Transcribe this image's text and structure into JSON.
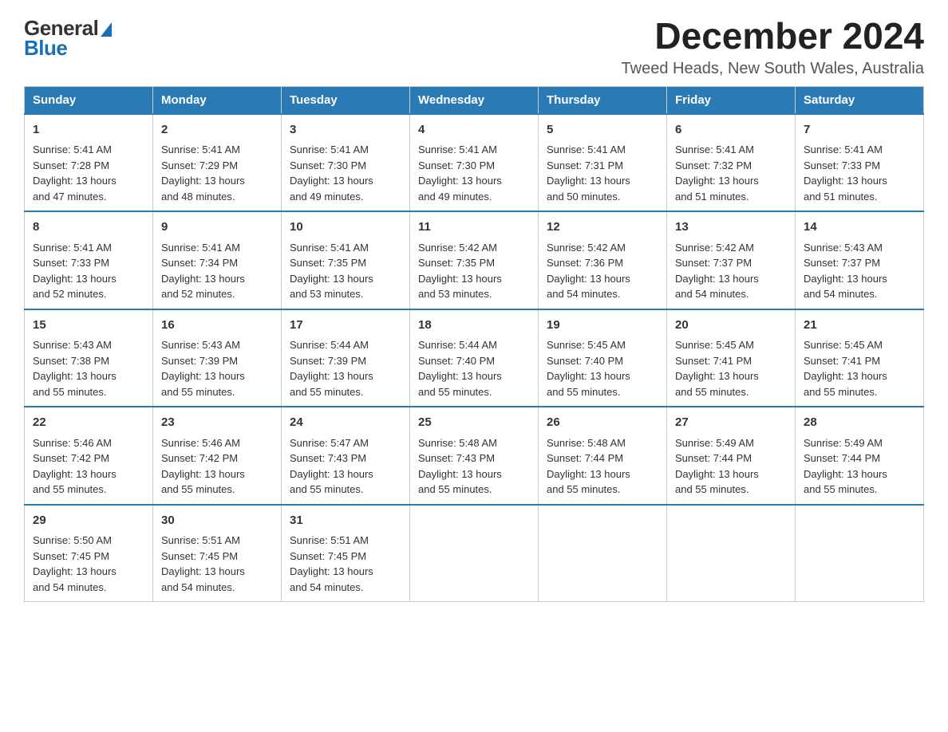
{
  "header": {
    "month_year": "December 2024",
    "location": "Tweed Heads, New South Wales, Australia",
    "logo_general": "General",
    "logo_blue": "Blue"
  },
  "weekdays": [
    "Sunday",
    "Monday",
    "Tuesday",
    "Wednesday",
    "Thursday",
    "Friday",
    "Saturday"
  ],
  "weeks": [
    [
      {
        "day": "1",
        "sunrise": "5:41 AM",
        "sunset": "7:28 PM",
        "daylight": "13 hours and 47 minutes."
      },
      {
        "day": "2",
        "sunrise": "5:41 AM",
        "sunset": "7:29 PM",
        "daylight": "13 hours and 48 minutes."
      },
      {
        "day": "3",
        "sunrise": "5:41 AM",
        "sunset": "7:30 PM",
        "daylight": "13 hours and 49 minutes."
      },
      {
        "day": "4",
        "sunrise": "5:41 AM",
        "sunset": "7:30 PM",
        "daylight": "13 hours and 49 minutes."
      },
      {
        "day": "5",
        "sunrise": "5:41 AM",
        "sunset": "7:31 PM",
        "daylight": "13 hours and 50 minutes."
      },
      {
        "day": "6",
        "sunrise": "5:41 AM",
        "sunset": "7:32 PM",
        "daylight": "13 hours and 51 minutes."
      },
      {
        "day": "7",
        "sunrise": "5:41 AM",
        "sunset": "7:33 PM",
        "daylight": "13 hours and 51 minutes."
      }
    ],
    [
      {
        "day": "8",
        "sunrise": "5:41 AM",
        "sunset": "7:33 PM",
        "daylight": "13 hours and 52 minutes."
      },
      {
        "day": "9",
        "sunrise": "5:41 AM",
        "sunset": "7:34 PM",
        "daylight": "13 hours and 52 minutes."
      },
      {
        "day": "10",
        "sunrise": "5:41 AM",
        "sunset": "7:35 PM",
        "daylight": "13 hours and 53 minutes."
      },
      {
        "day": "11",
        "sunrise": "5:42 AM",
        "sunset": "7:35 PM",
        "daylight": "13 hours and 53 minutes."
      },
      {
        "day": "12",
        "sunrise": "5:42 AM",
        "sunset": "7:36 PM",
        "daylight": "13 hours and 54 minutes."
      },
      {
        "day": "13",
        "sunrise": "5:42 AM",
        "sunset": "7:37 PM",
        "daylight": "13 hours and 54 minutes."
      },
      {
        "day": "14",
        "sunrise": "5:43 AM",
        "sunset": "7:37 PM",
        "daylight": "13 hours and 54 minutes."
      }
    ],
    [
      {
        "day": "15",
        "sunrise": "5:43 AM",
        "sunset": "7:38 PM",
        "daylight": "13 hours and 55 minutes."
      },
      {
        "day": "16",
        "sunrise": "5:43 AM",
        "sunset": "7:39 PM",
        "daylight": "13 hours and 55 minutes."
      },
      {
        "day": "17",
        "sunrise": "5:44 AM",
        "sunset": "7:39 PM",
        "daylight": "13 hours and 55 minutes."
      },
      {
        "day": "18",
        "sunrise": "5:44 AM",
        "sunset": "7:40 PM",
        "daylight": "13 hours and 55 minutes."
      },
      {
        "day": "19",
        "sunrise": "5:45 AM",
        "sunset": "7:40 PM",
        "daylight": "13 hours and 55 minutes."
      },
      {
        "day": "20",
        "sunrise": "5:45 AM",
        "sunset": "7:41 PM",
        "daylight": "13 hours and 55 minutes."
      },
      {
        "day": "21",
        "sunrise": "5:45 AM",
        "sunset": "7:41 PM",
        "daylight": "13 hours and 55 minutes."
      }
    ],
    [
      {
        "day": "22",
        "sunrise": "5:46 AM",
        "sunset": "7:42 PM",
        "daylight": "13 hours and 55 minutes."
      },
      {
        "day": "23",
        "sunrise": "5:46 AM",
        "sunset": "7:42 PM",
        "daylight": "13 hours and 55 minutes."
      },
      {
        "day": "24",
        "sunrise": "5:47 AM",
        "sunset": "7:43 PM",
        "daylight": "13 hours and 55 minutes."
      },
      {
        "day": "25",
        "sunrise": "5:48 AM",
        "sunset": "7:43 PM",
        "daylight": "13 hours and 55 minutes."
      },
      {
        "day": "26",
        "sunrise": "5:48 AM",
        "sunset": "7:44 PM",
        "daylight": "13 hours and 55 minutes."
      },
      {
        "day": "27",
        "sunrise": "5:49 AM",
        "sunset": "7:44 PM",
        "daylight": "13 hours and 55 minutes."
      },
      {
        "day": "28",
        "sunrise": "5:49 AM",
        "sunset": "7:44 PM",
        "daylight": "13 hours and 55 minutes."
      }
    ],
    [
      {
        "day": "29",
        "sunrise": "5:50 AM",
        "sunset": "7:45 PM",
        "daylight": "13 hours and 54 minutes."
      },
      {
        "day": "30",
        "sunrise": "5:51 AM",
        "sunset": "7:45 PM",
        "daylight": "13 hours and 54 minutes."
      },
      {
        "day": "31",
        "sunrise": "5:51 AM",
        "sunset": "7:45 PM",
        "daylight": "13 hours and 54 minutes."
      },
      null,
      null,
      null,
      null
    ]
  ],
  "labels": {
    "sunrise": "Sunrise:",
    "sunset": "Sunset:",
    "daylight": "Daylight:"
  }
}
